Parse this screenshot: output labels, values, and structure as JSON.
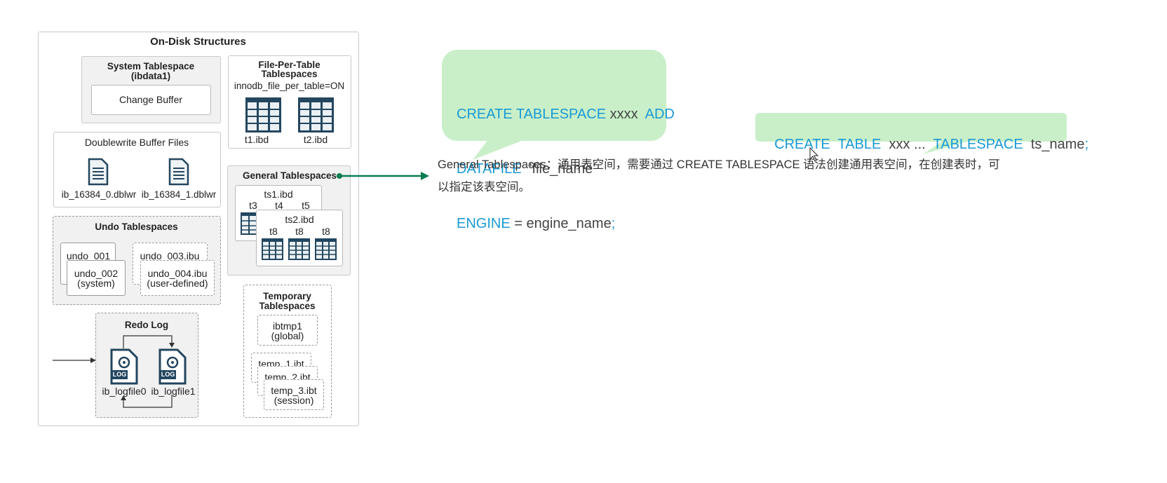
{
  "diagram": {
    "title": "On-Disk Structures",
    "system_tablespace": {
      "title_line1": "System Tablespace",
      "title_line2": "(ibdata1)",
      "change_buffer": "Change Buffer"
    },
    "file_per_table": {
      "title_line1": "File-Per-Table",
      "title_line2": "Tablespaces",
      "setting": "innodb_file_per_table=ON",
      "files": [
        "t1.ibd",
        "t2.ibd"
      ]
    },
    "doublewrite": {
      "title": "Doublewrite Buffer Files",
      "files": [
        "ib_16384_0.dblwr",
        "ib_16384_1.dblwr"
      ]
    },
    "general": {
      "title": "General Tablespaces",
      "ts1": {
        "name": "ts1.ibd",
        "tables": [
          "t3",
          "t4",
          "t5"
        ]
      },
      "ts2": {
        "name": "ts2.ibd",
        "tables": [
          "t8",
          "t8",
          "t8"
        ]
      }
    },
    "undo": {
      "title": "Undo Tablespaces",
      "undo_001": "undo_001",
      "undo_002": "undo_002",
      "undo_002_sub": "(system)",
      "undo_003": "undo_003.ibu",
      "undo_004": "undo_004.ibu",
      "undo_004_sub": "(user-defined)"
    },
    "temporary": {
      "title_line1": "Temporary",
      "title_line2": "Tablespaces",
      "ibtmp1": "ibtmp1",
      "ibtmp1_sub": "(global)",
      "temp1": "temp_1.ibt",
      "temp2": "temp_2.ibt",
      "temp3": "temp_3.ibt",
      "temp3_sub": "(session)"
    },
    "redo": {
      "title": "Redo Log",
      "files": [
        "ib_logfile0",
        "ib_logfile1"
      ],
      "log_badge": "LOG"
    }
  },
  "callout_create_tablespace": {
    "line1_kw": "CREATE TABLESPACE",
    "line1_name": "xxxx",
    "line1_kw2": "ADD",
    "line2_kw": "DATAFILE",
    "line2_val": "'file_name'",
    "line3_kw": "ENGINE",
    "line3_val": "= engine_name",
    "line3_end": ";"
  },
  "callout_create_table": {
    "kw1": "CREATE  TABLE",
    "name": "xxx ...",
    "kw2": "TABLESPACE",
    "val": "ts_name",
    "end": ";"
  },
  "description": {
    "line1": "General Tablespaces：通用表空间，需要通过 CREATE  TABLESPACE 语法创建通用表空间，在创建表时，可",
    "line2": "以指定该表空间。"
  },
  "colors": {
    "arrow": "#0b7d4e",
    "bubble": "#c9efc8",
    "keyword": "#1a9ad6",
    "icon": "#23465f"
  }
}
